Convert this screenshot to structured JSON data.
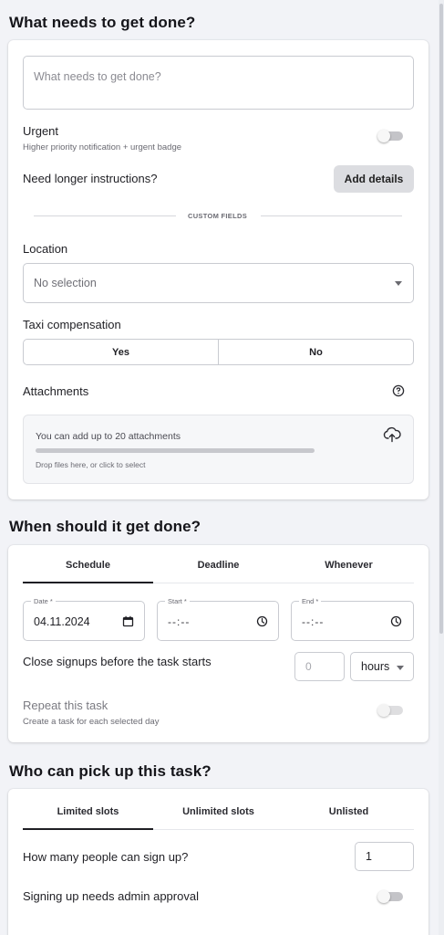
{
  "task_section": {
    "title": "What needs to get done?",
    "task_input": {
      "value": "",
      "placeholder": "What needs to get done?"
    },
    "urgent": {
      "label": "Urgent",
      "description": "Higher priority notification + urgent badge",
      "enabled": false
    },
    "instructions": {
      "label": "Need longer instructions?",
      "button_label": "Add details"
    },
    "custom_fields_divider": "CUSTOM FIELDS",
    "location": {
      "label": "Location",
      "selected": "No selection"
    },
    "taxi": {
      "label": "Taxi compensation",
      "options": [
        "Yes",
        "No"
      ]
    },
    "attachments": {
      "label": "Attachments",
      "dropzone_title": "You can add up to 20 attachments",
      "dropzone_hint": "Drop files here, or click to select"
    }
  },
  "when_section": {
    "title": "When should it get done?",
    "tabs": [
      "Schedule",
      "Deadline",
      "Whenever"
    ],
    "active_tab": "Schedule",
    "date": {
      "legend": "Date *",
      "value": "04.11.2024"
    },
    "start": {
      "legend": "Start *",
      "value": "--:--"
    },
    "end": {
      "legend": "End *",
      "value": "--:--"
    },
    "close_signups": {
      "label": "Close signups before the task starts",
      "value": "",
      "placeholder": "0",
      "unit": "hours"
    },
    "repeat": {
      "label": "Repeat this task",
      "description": "Create a task for each selected day",
      "enabled": false
    }
  },
  "who_section": {
    "title": "Who can pick up this task?",
    "tabs": [
      "Limited slots",
      "Unlimited slots",
      "Unlisted"
    ],
    "active_tab": "Limited slots",
    "slots": {
      "label": "How many people can sign up?",
      "value": "1"
    },
    "approval": {
      "label": "Signing up needs admin approval",
      "enabled": false
    }
  },
  "icons": {
    "dropdown": "caret-down-icon",
    "help": "question-circle-icon",
    "upload": "cloud-upload-icon",
    "calendar": "calendar-icon",
    "clock": "clock-icon"
  }
}
